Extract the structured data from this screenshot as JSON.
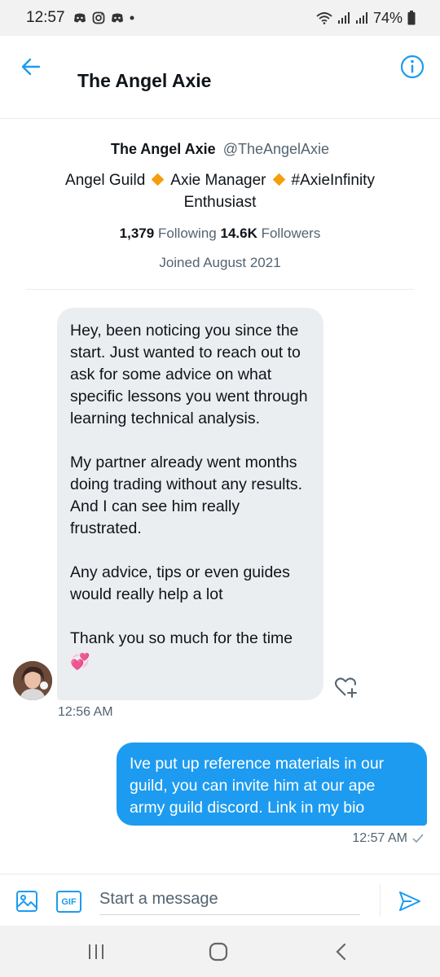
{
  "status_bar": {
    "time": "12:57",
    "battery": "74%",
    "left_icons": [
      "discord-icon",
      "instagram-icon",
      "discord-icon",
      "dot-icon"
    ],
    "right_icons": [
      "wifi-icon",
      "signal-icon",
      "signal-icon",
      "battery-icon"
    ]
  },
  "header": {
    "title": "The Angel Axie",
    "back_icon": "arrow-left-icon",
    "info_icon": "info-icon",
    "accent_color": "#1d9bf0"
  },
  "profile": {
    "name": "The Angel Axie",
    "handle": "@TheAngelAxie",
    "bio_part1": "Angel Guild",
    "bio_part2": "Axie Manager",
    "bio_part3": "#AxieInfinity",
    "bio_part4": "Enthusiast",
    "following_count": "1,379",
    "following_label": "Following",
    "followers_count": "14.6K",
    "followers_label": "Followers",
    "joined": "Joined August 2021"
  },
  "messages": {
    "incoming": {
      "p1": "Hey, been noticing you since the start. Just wanted to reach out to ask for some advice on what specific lessons you went through learning technical analysis.",
      "p2": "My partner already went months doing trading without any results. And I can see him really frustrated.",
      "p3": "Any advice, tips or even guides would really help a lot",
      "p4": "Thank you so much for the time",
      "emoji": "💞",
      "time": "12:56 AM"
    },
    "outgoing": {
      "text": "Ive put up reference materials in our guild, you can invite him at our ape army guild discord. Link in my bio",
      "time": "12:57 AM"
    }
  },
  "composer": {
    "placeholder": "Start a message",
    "gif_label": "GIF"
  },
  "colors": {
    "incoming_bubble": "#ebeef0",
    "outgoing_bubble": "#1d9bf0",
    "diamond": "#f59e0b"
  }
}
